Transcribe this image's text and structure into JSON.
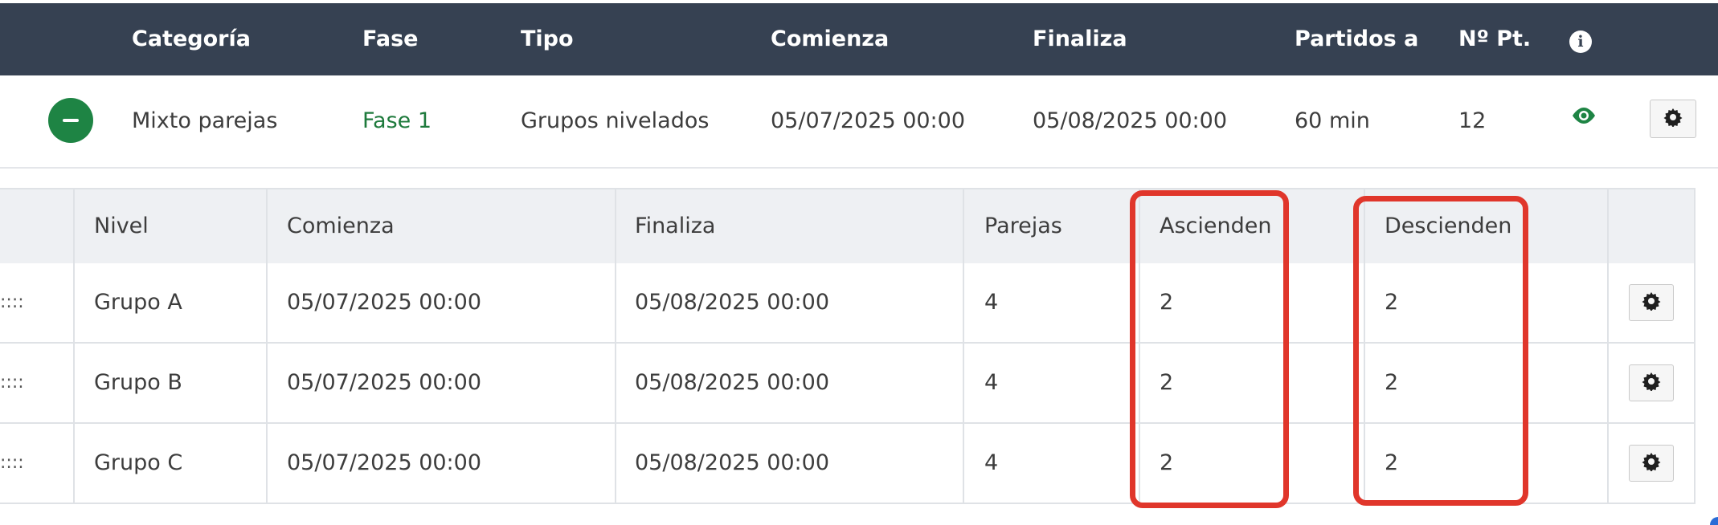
{
  "phase_table": {
    "headers": {
      "categoria": "Categoría",
      "fase": "Fase",
      "tipo": "Tipo",
      "comienza": "Comienza",
      "finaliza": "Finaliza",
      "partidos_a": "Partidos a",
      "num_pt": "Nº Pt.",
      "info_icon": "i"
    },
    "row": {
      "categoria": "Mixto parejas",
      "fase": "Fase 1",
      "tipo": "Grupos nivelados",
      "comienza": "05/07/2025 00:00",
      "finaliza": "05/08/2025 00:00",
      "partidos_a": "60 min",
      "num_pt": "12",
      "icons": [
        "minus-circle-icon",
        "eye-icon",
        "gear-icon"
      ]
    }
  },
  "groups_table": {
    "headers": {
      "nivel": "Nivel",
      "comienza": "Comienza",
      "finaliza": "Finaliza",
      "parejas": "Parejas",
      "ascienden": "Ascienden",
      "descienden": "Descienden"
    },
    "drag_handle": "::::",
    "rows": [
      {
        "nivel": "Grupo A",
        "comienza": "05/07/2025 00:00",
        "finaliza": "05/08/2025 00:00",
        "parejas": "4",
        "ascienden": "2",
        "descienden": "2"
      },
      {
        "nivel": "Grupo B",
        "comienza": "05/07/2025 00:00",
        "finaliza": "05/08/2025 00:00",
        "parejas": "4",
        "ascienden": "2",
        "descienden": "2"
      },
      {
        "nivel": "Grupo C",
        "comienza": "05/07/2025 00:00",
        "finaliza": "05/08/2025 00:00",
        "parejas": "4",
        "ascienden": "2",
        "descienden": "2"
      }
    ]
  },
  "colors": {
    "header_bg": "#364152",
    "link_green": "#1e7a3c",
    "button_green": "#1e8444",
    "highlight_red": "#e0362b"
  }
}
